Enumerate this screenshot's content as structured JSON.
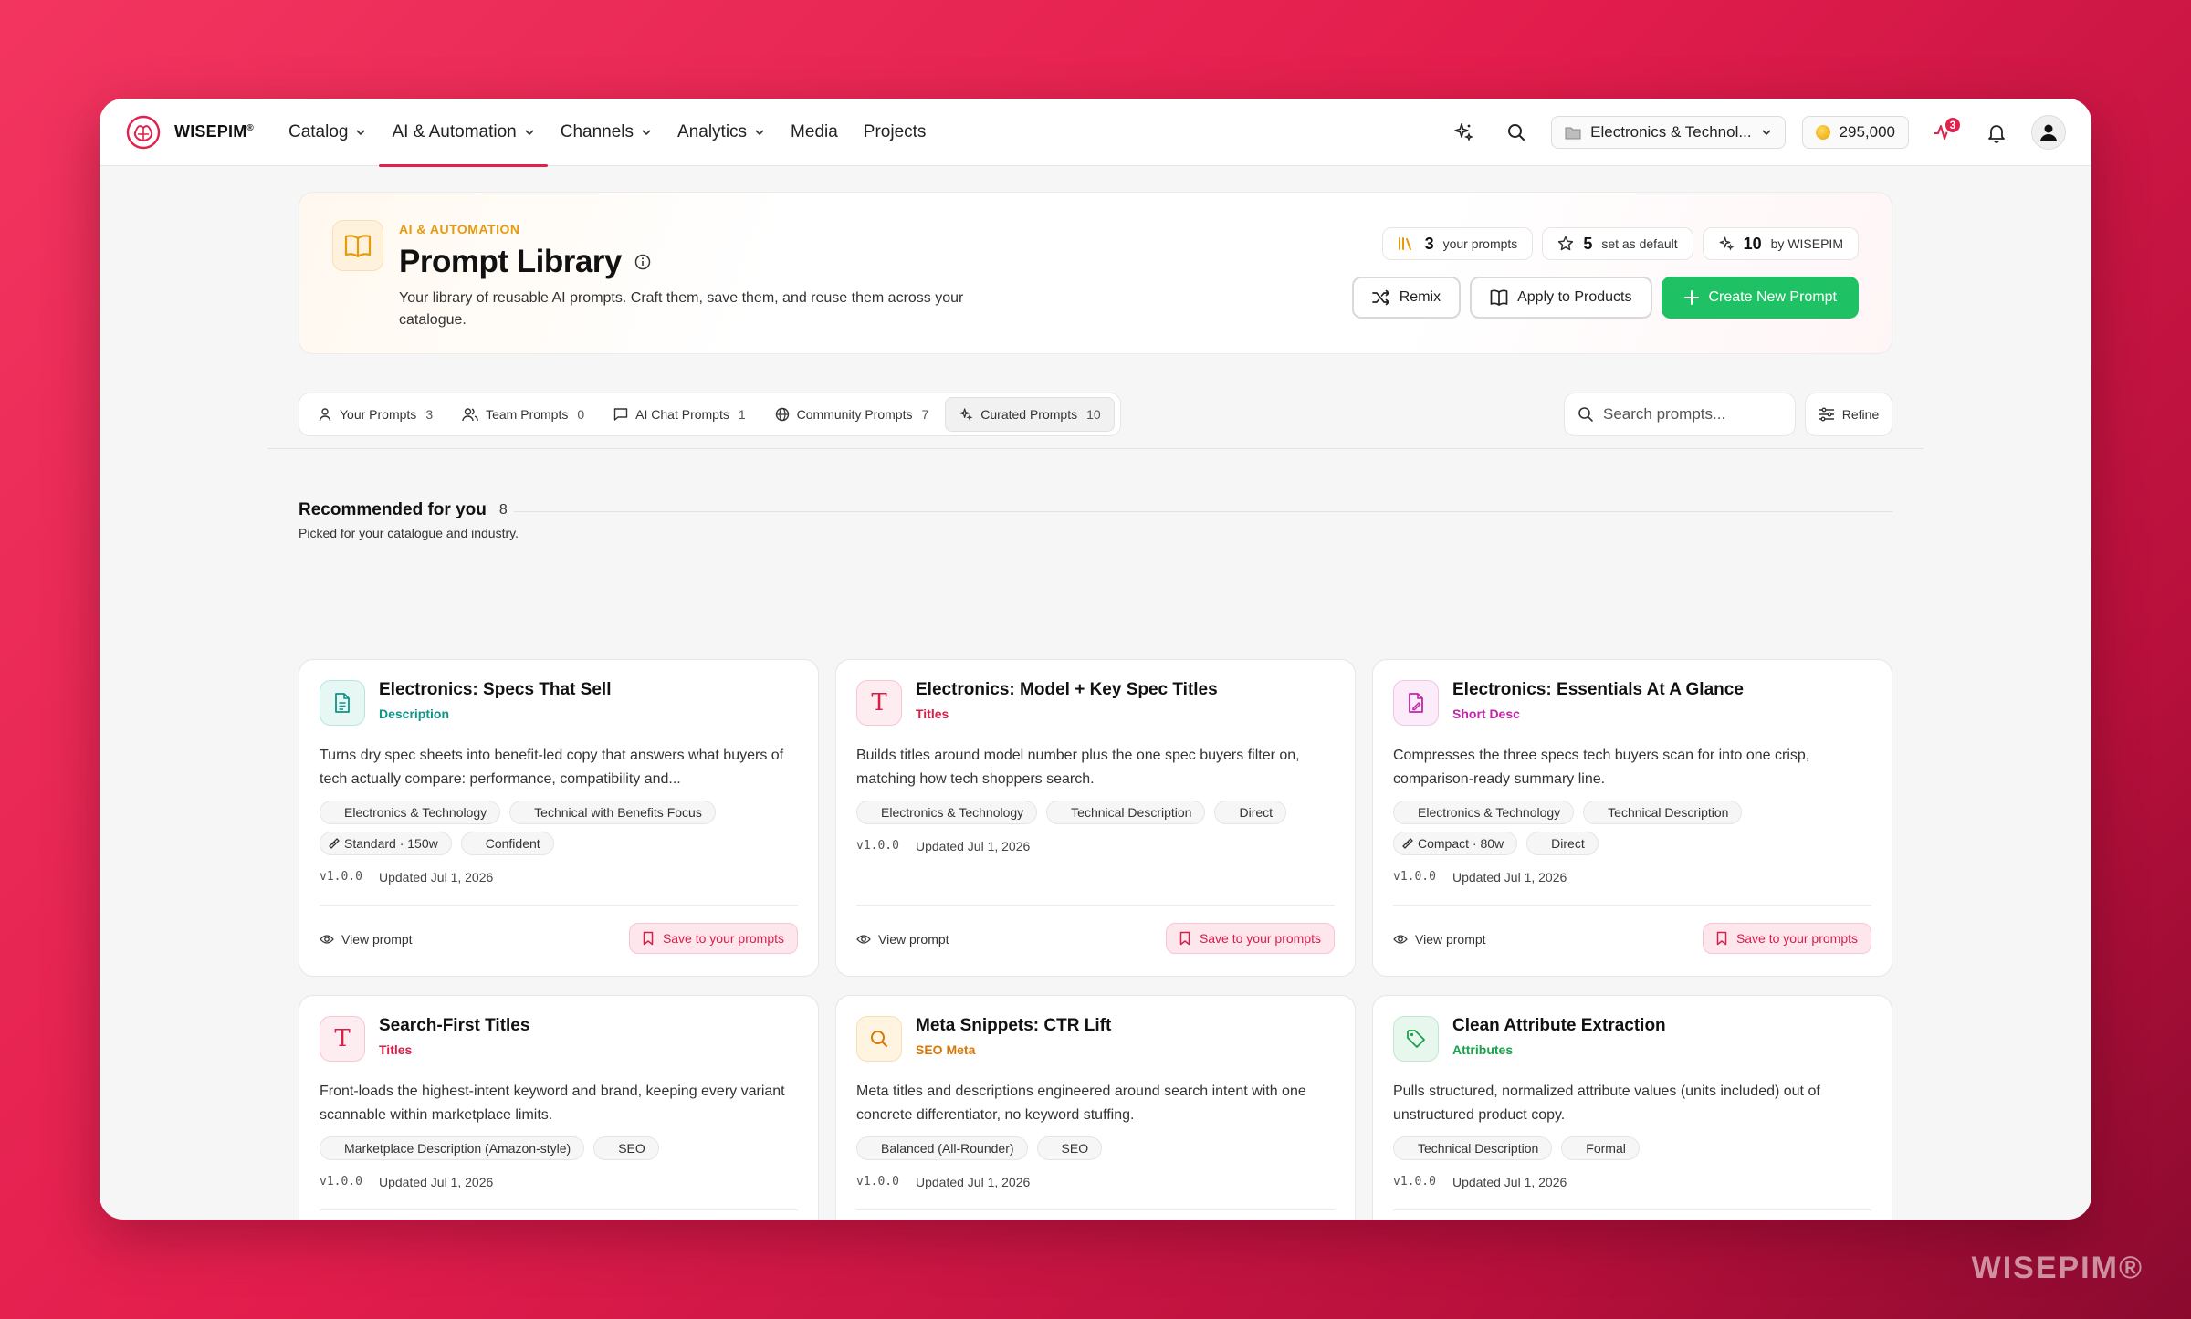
{
  "nav": {
    "brand": "WISEPIM",
    "brand_mark": "®",
    "items": [
      {
        "label": "Catalog",
        "dropdown": true
      },
      {
        "label": "AI & Automation",
        "dropdown": true,
        "active": true
      },
      {
        "label": "Channels",
        "dropdown": true
      },
      {
        "label": "Analytics",
        "dropdown": true
      },
      {
        "label": "Media",
        "dropdown": false
      },
      {
        "label": "Projects",
        "dropdown": false
      }
    ],
    "workspace": "Electronics & Technol...",
    "credits": "295,000",
    "activity_badge": "3"
  },
  "header": {
    "eyebrow": "AI & AUTOMATION",
    "title": "Prompt Library",
    "description": "Your library of reusable AI prompts. Craft them, save them, and reuse them across your catalogue.",
    "stats": [
      {
        "value": "3",
        "label": "your prompts",
        "icon": "books-icon"
      },
      {
        "value": "5",
        "label": "set as default",
        "icon": "star-icon"
      },
      {
        "value": "10",
        "label": "by WISEPIM",
        "icon": "sparkle-icon"
      }
    ],
    "actions": {
      "remix": "Remix",
      "apply": "Apply to Products",
      "create": "Create New Prompt"
    }
  },
  "tabs": [
    {
      "label": "Your Prompts",
      "count": "3",
      "icon": "user-icon"
    },
    {
      "label": "Team Prompts",
      "count": "0",
      "icon": "users-icon"
    },
    {
      "label": "AI Chat Prompts",
      "count": "1",
      "icon": "chat-icon"
    },
    {
      "label": "Community Prompts",
      "count": "7",
      "icon": "globe-icon"
    },
    {
      "label": "Curated Prompts",
      "count": "10",
      "icon": "sparkle-icon",
      "active": true
    }
  ],
  "search": {
    "placeholder": "Search prompts..."
  },
  "refine_label": "Refine",
  "section": {
    "title": "Recommended for you",
    "count": "8",
    "subtitle": "Picked for your catalogue and industry."
  },
  "card_actions": {
    "view": "View prompt",
    "save": "Save to your prompts"
  },
  "cards": [
    {
      "title": "Electronics: Specs That Sell",
      "category": "Description",
      "category_color": "#0e9488",
      "icon": "document-icon",
      "description": "Turns dry spec sheets into benefit-led copy that answers what buyers of tech actually compare: performance, compatibility and...",
      "chips": [
        "Electronics & Technology",
        "Technical with Benefits Focus"
      ],
      "length": "Standard · 150w",
      "chips2": [
        "Confident"
      ],
      "version": "v1.0.0",
      "updated": "Updated Jul 1, 2026"
    },
    {
      "title": "Electronics: Model + Key Spec Titles",
      "category": "Titles",
      "category_color": "#d91e4a",
      "icon": "title-t-icon",
      "description": "Builds titles around model number plus the one spec buyers filter on, matching how tech shoppers search.",
      "chips": [
        "Electronics & Technology",
        "Technical Description",
        "Direct"
      ],
      "length": "",
      "chips2": [],
      "version": "v1.0.0",
      "updated": "Updated Jul 1, 2026"
    },
    {
      "title": "Electronics: Essentials At A Glance",
      "category": "Short Desc",
      "category_color": "#c026a6",
      "icon": "short-doc-icon",
      "description": "Compresses the three specs tech buyers scan for into one crisp, comparison-ready summary line.",
      "chips": [
        "Electronics & Technology",
        "Technical Description"
      ],
      "length": "Compact · 80w",
      "chips2": [
        "Direct"
      ],
      "version": "v1.0.0",
      "updated": "Updated Jul 1, 2026"
    },
    {
      "title": "Search-First Titles",
      "category": "Titles",
      "category_color": "#d91e4a",
      "icon": "title-t-icon",
      "description": "Front-loads the highest-intent keyword and brand, keeping every variant scannable within marketplace limits.",
      "chips": [
        "Marketplace Description (Amazon-style)",
        "SEO"
      ],
      "length": "",
      "chips2": [],
      "version": "v1.0.0",
      "updated": "Updated Jul 1, 2026"
    },
    {
      "title": "Meta Snippets: CTR Lift",
      "category": "SEO Meta",
      "category_color": "#d97706",
      "icon": "search-icon",
      "description": "Meta titles and descriptions engineered around search intent with one concrete differentiator, no keyword stuffing.",
      "chips": [
        "Balanced (All-Rounder)",
        "SEO"
      ],
      "length": "",
      "chips2": [],
      "version": "v1.0.0",
      "updated": "Updated Jul 1, 2026"
    },
    {
      "title": "Clean Attribute Extraction",
      "category": "Attributes",
      "category_color": "#16a34a",
      "icon": "tag-icon",
      "description": "Pulls structured, normalized attribute values (units included) out of unstructured product copy.",
      "chips": [
        "Technical Description",
        "Formal"
      ],
      "length": "",
      "chips2": [],
      "version": "v1.0.0",
      "updated": "Updated Jul 1, 2026"
    }
  ],
  "watermark": "WISEPIM®"
}
